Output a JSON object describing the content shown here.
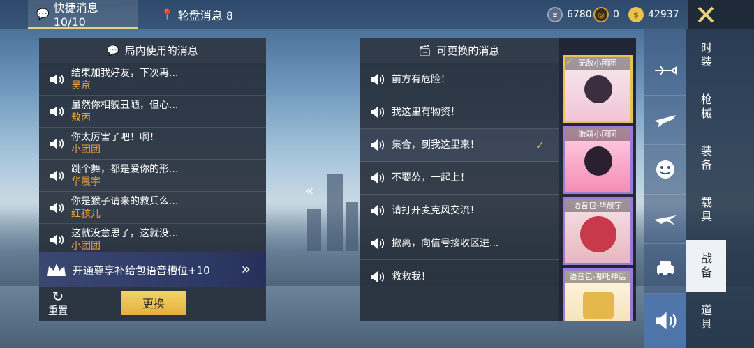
{
  "tabs": [
    {
      "label": "快捷消息 10/10",
      "active": true
    },
    {
      "label": "轮盘消息 8",
      "active": false
    }
  ],
  "currency": [
    {
      "value": "6780",
      "icon": "ticket-coin-icon",
      "color": "#5c6a86"
    },
    {
      "value": "0",
      "icon": "bronze-coin-icon",
      "color": "#d3a23a"
    },
    {
      "value": "42937",
      "icon": "gold-coin-icon",
      "color": "#e9c24a"
    }
  ],
  "left_panel": {
    "title": "局内使用的消息",
    "messages": [
      {
        "text": "结束加我好友，下次再...",
        "sub": "吴京"
      },
      {
        "text": "虽然你相貌丑陋，但心...",
        "sub": "敖丙"
      },
      {
        "text": "你太厉害了吧！啊！",
        "sub": "小团团"
      },
      {
        "text": "跳个舞，都是爱你的形...",
        "sub": "华晨宇"
      },
      {
        "text": "你是猴子请来的救兵么...",
        "sub": "红孩儿"
      },
      {
        "text": "这就没意思了，这就没...",
        "sub": "小团团"
      }
    ],
    "promo": "开通尊享补给包语音槽位+10",
    "reset_label": "重置",
    "swap_label": "更换"
  },
  "right_panel": {
    "title": "可更换的消息",
    "messages": [
      {
        "text": "前方有危险！",
        "selected": false
      },
      {
        "text": "我这里有物资！",
        "selected": false
      },
      {
        "text": "集合，到我这里来！",
        "selected": true
      },
      {
        "text": "不要怂，一起上！",
        "selected": false
      },
      {
        "text": "请打开麦克风交流！",
        "selected": false
      },
      {
        "text": "撤离，向信号接收区进...",
        "selected": false
      },
      {
        "text": "救救我！",
        "selected": false
      }
    ]
  },
  "voice_packs": [
    {
      "label": "无敌小团团",
      "selected": true,
      "colors": [
        "#f7e9ef",
        "#f1c6d6"
      ]
    },
    {
      "label": "激萌小团团",
      "selected": false,
      "colors": [
        "#ffd2e3",
        "#f58db5"
      ]
    },
    {
      "label": "语音包-华晨宇",
      "selected": false,
      "colors": [
        "#f4e4e6",
        "#c83a4b"
      ]
    },
    {
      "label": "语音包-哪吒神话",
      "selected": false,
      "colors": [
        "#fff7e6",
        "#e6b84b"
      ]
    }
  ],
  "side_nav": [
    {
      "label": "时装",
      "active": false
    },
    {
      "label": "枪械",
      "active": false
    },
    {
      "label": "装备",
      "active": false
    },
    {
      "label": "载具",
      "active": false
    },
    {
      "label": "战备",
      "active": true
    },
    {
      "label": "道具",
      "active": false
    }
  ],
  "side_icons": [
    {
      "icon": "parachute-plane-icon"
    },
    {
      "icon": "airplane-icon"
    },
    {
      "icon": "emote-face-icon"
    },
    {
      "icon": "glider-icon"
    },
    {
      "icon": "car-icon"
    },
    {
      "icon": "speaker-icon",
      "active": true
    }
  ]
}
